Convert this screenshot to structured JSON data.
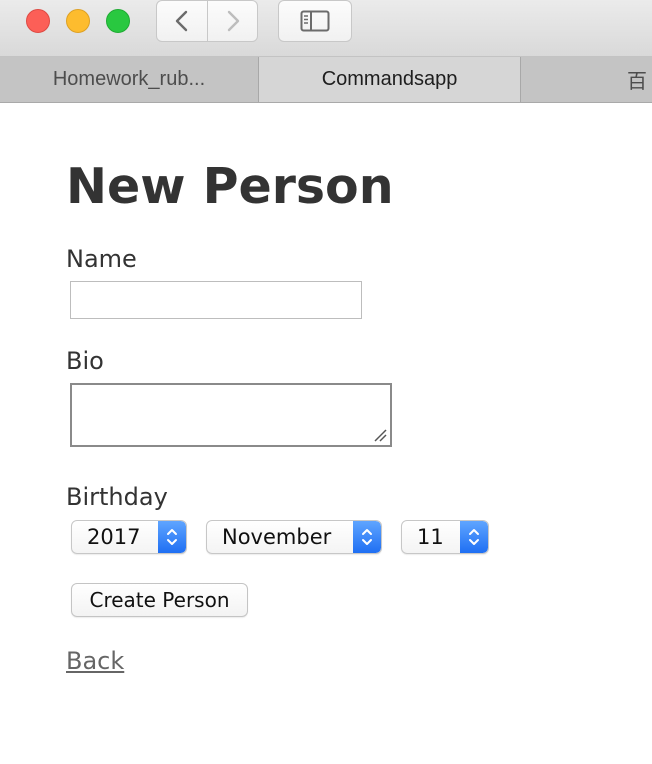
{
  "browser": {
    "tabs": [
      {
        "label": "Homework_rub...",
        "active": false
      },
      {
        "label": "Commandsapp",
        "active": true
      },
      {
        "label": "百",
        "active": false
      }
    ],
    "icons": {
      "back": "chevron-left-icon",
      "forward": "chevron-right-icon",
      "sidebar": "sidebar-icon"
    },
    "colors": {
      "close": "#fc5f57",
      "minimize": "#fdbc2e",
      "zoom": "#29c840",
      "select_accent": "#2f80f6"
    }
  },
  "page": {
    "title": "New Person",
    "form": {
      "name_label": "Name",
      "name_value": "",
      "bio_label": "Bio",
      "bio_value": "",
      "birthday_label": "Birthday",
      "birthday": {
        "year": "2017",
        "month": "November",
        "day": "11"
      },
      "submit_label": "Create Person"
    },
    "back_link": "Back"
  }
}
